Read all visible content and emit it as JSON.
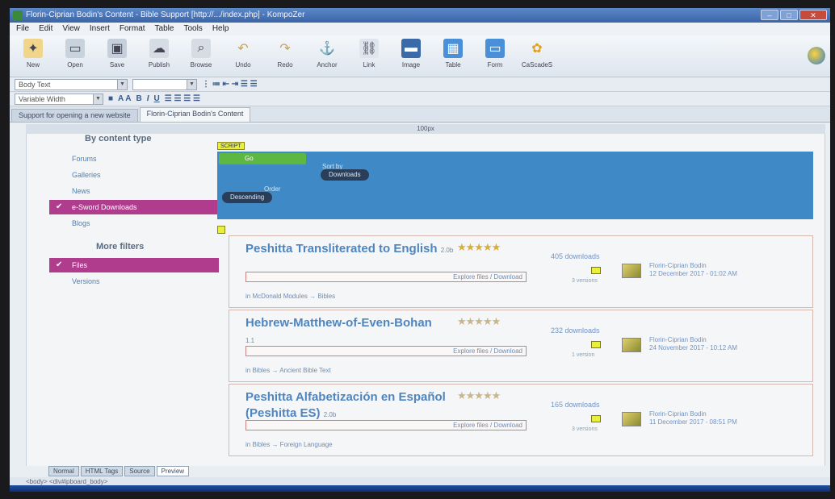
{
  "window": {
    "title": "Florin-Ciprian Bodin's Content - Bible Support [http://.../index.php] - KompoZer",
    "controls": [
      "–",
      "□",
      "✕"
    ]
  },
  "menu": [
    "File",
    "Edit",
    "View",
    "Insert",
    "Format",
    "Table",
    "Tools",
    "Help"
  ],
  "toolbar": [
    {
      "label": "New",
      "icon": "new-icon"
    },
    {
      "label": "Open",
      "icon": "open-icon"
    },
    {
      "label": "Save",
      "icon": "save-icon"
    },
    {
      "label": "Publish",
      "icon": "publish-icon"
    },
    {
      "label": "Browse",
      "icon": "browse-icon"
    },
    {
      "label": "Undo",
      "icon": "undo-icon"
    },
    {
      "label": "Redo",
      "icon": "redo-icon"
    },
    {
      "label": "Anchor",
      "icon": "anchor-icon"
    },
    {
      "label": "Link",
      "icon": "link-icon"
    },
    {
      "label": "Image",
      "icon": "image-icon"
    },
    {
      "label": "Table",
      "icon": "table-icon"
    },
    {
      "label": "Form",
      "icon": "form-icon"
    },
    {
      "label": "CaScadeS",
      "icon": "cascades-icon"
    }
  ],
  "format": {
    "paragraph_style": "Body Text",
    "font": "Variable Width"
  },
  "tabs": [
    {
      "label": "Support for opening a new website"
    },
    {
      "label": "Florin-Ciprian Bodin's Content"
    }
  ],
  "ruler": "100px",
  "sidebar": {
    "heading": "By content type",
    "items": [
      {
        "label": "Forums",
        "active": false
      },
      {
        "label": "Galleries",
        "active": false
      },
      {
        "label": "News",
        "active": false
      },
      {
        "label": "e-Sword Downloads",
        "active": true
      },
      {
        "label": "Blogs",
        "active": false
      }
    ],
    "more_heading": "More filters",
    "more_items": [
      {
        "label": "Files",
        "active": true
      },
      {
        "label": "Versions",
        "active": false
      }
    ]
  },
  "filters": {
    "scope_tag": "SCRIPT",
    "go_button": "Go",
    "sort_label": "Sort by",
    "sort_value": "Downloads",
    "order_label": "Order",
    "order_value": "Descending"
  },
  "results": [
    {
      "title": "Peshitta Transliterated to English",
      "version": "2.0b",
      "explore": "Explore files / Download",
      "category": "in McDonald Modules → Bibles",
      "downloads": "405 downloads",
      "sub": "3 versions",
      "author": "Florin-Ciprian Bodin",
      "date": "12 December 2017 - 01:02 AM",
      "rating": 5
    },
    {
      "title": "Hebrew-Matthew-of-Even-Bohan",
      "version": "1.1",
      "explore": "Explore files / Download",
      "category": "in Bibles → Ancient Bible Text",
      "downloads": "232 downloads",
      "sub": "1 version",
      "author": "Florin-Ciprian Bodin",
      "date": "24 November 2017 - 10:12 AM",
      "rating": 0
    },
    {
      "title": "Peshitta Alfabetización en Español (Peshitta ES)",
      "version": "2.0b",
      "explore": "Explore files / Download",
      "category": "in Bibles → Foreign Language",
      "downloads": "165 downloads",
      "sub": "3 versions",
      "author": "Florin-Ciprian Bodin",
      "date": "11 December 2017 - 08:51 PM",
      "rating": 0
    }
  ],
  "viewtabs": [
    "Normal",
    "HTML Tags",
    "Source",
    "Preview"
  ],
  "status": "<body> <div#ipboard_body>"
}
